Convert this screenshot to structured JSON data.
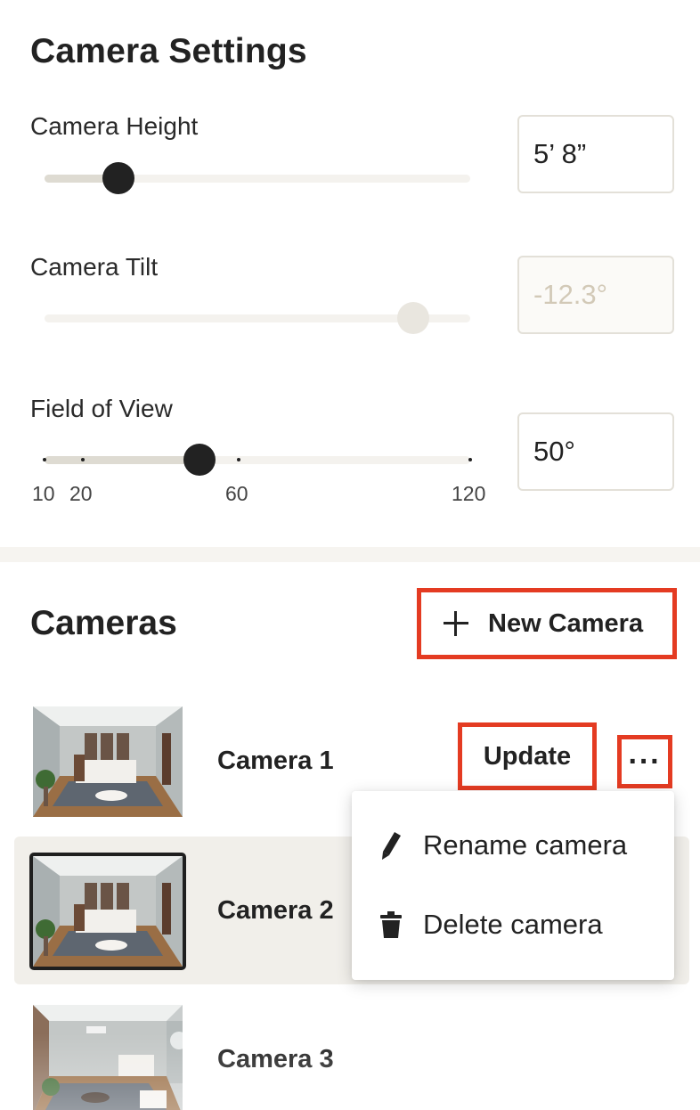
{
  "settings": {
    "title": "Camera Settings",
    "height": {
      "label": "Camera Height",
      "value": "5’ 8”",
      "slider_fraction": 0.17,
      "disabled": false
    },
    "tilt": {
      "label": "Camera Tilt",
      "value": "-12.3°",
      "slider_fraction": 0.87,
      "disabled": true
    },
    "fov": {
      "label": "Field of View",
      "value": "50°",
      "slider_value": 50,
      "min": 10,
      "max": 120,
      "ticks": [
        "10",
        "20",
        "60",
        "120"
      ]
    }
  },
  "cameras": {
    "title": "Cameras",
    "new_button_label": "New Camera",
    "items": [
      {
        "name": "Camera 1",
        "selected": false
      },
      {
        "name": "Camera 2",
        "selected": true
      },
      {
        "name": "Camera 3",
        "selected": false
      }
    ],
    "update_label": "Update",
    "more_label": "···",
    "menu": {
      "rename": "Rename camera",
      "delete": "Delete camera"
    }
  },
  "colors": {
    "highlight": "#e43b22",
    "selected_row": "#f1efea",
    "thumb": "#222222"
  },
  "icons": {
    "add": "plus-icon",
    "more": "more-horizontal-icon",
    "rename": "pencil-icon",
    "delete": "trash-icon"
  }
}
